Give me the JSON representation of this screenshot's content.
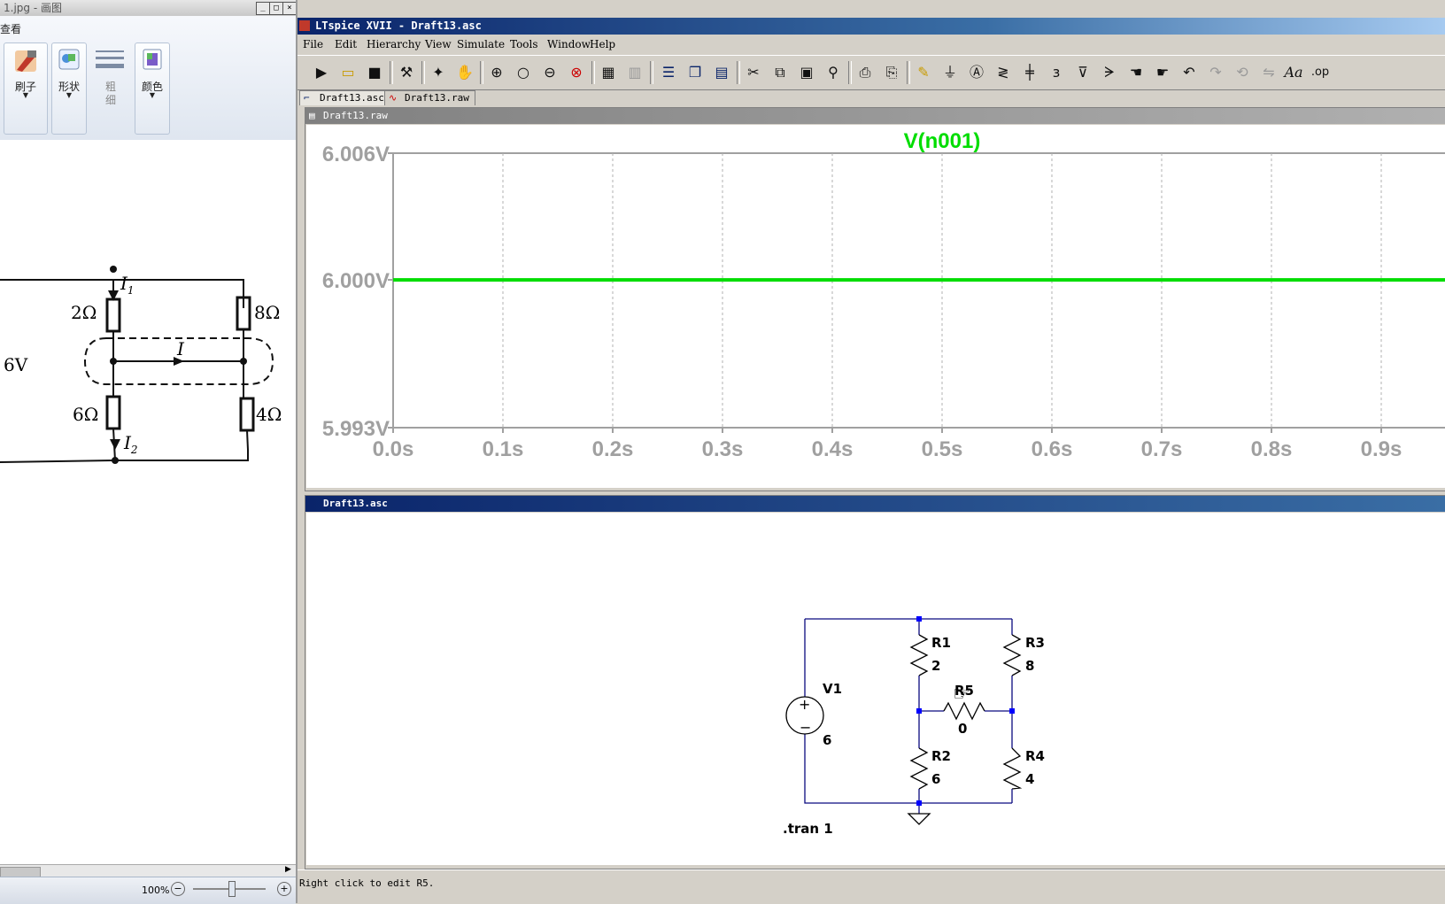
{
  "paint": {
    "title": "1.jpg - 画图",
    "tab_view": "查看",
    "ribbon": {
      "brushes": "刷子",
      "shapes": "形状",
      "size_line1": "粗",
      "size_line2": "细",
      "colors": "颜色"
    },
    "zoom": "100%",
    "figure": {
      "label_i1": "I",
      "sub_i1": "1",
      "label_i2": "I",
      "sub_i2": "2",
      "label_i": "I",
      "r_top_left": "2Ω",
      "r_top_right": "8Ω",
      "r_bot_left": "6Ω",
      "r_bot_right": "4Ω",
      "source": "6V"
    }
  },
  "ltspice": {
    "title": "LTspice XVII - Draft13.asc",
    "menu": [
      "File",
      "Edit",
      "Hierarchy",
      "View",
      "Simulate",
      "Tools",
      "Window",
      "Help"
    ],
    "tabs": [
      "Draft13.asc",
      "Draft13.raw"
    ],
    "waveform_window_title": "Draft13.raw",
    "schematic_window_title": "Draft13.asc",
    "status": "Right click to edit R5.",
    "toolbar_icons": [
      "run-icon",
      "open-icon",
      "save-icon",
      "control-panel-icon",
      "run-sim-icon",
      "pan-icon",
      "zoom-in-icon",
      "zoom-area-icon",
      "zoom-out-icon",
      "zoom-cancel-icon",
      "plot-icon",
      "plot-settings-icon",
      "tile-h-icon",
      "cascade-icon",
      "tile-v-icon",
      "cut-icon",
      "copy-icon",
      "paste-icon",
      "find-icon",
      "print-icon",
      "print-setup-icon",
      "wire-icon",
      "ground-icon",
      "label-icon",
      "resistor-icon",
      "capacitor-icon",
      "inductor-icon",
      "diode-icon",
      "component-icon",
      "move-icon",
      "drag-icon",
      "undo-icon",
      "redo-icon",
      "rotate-icon",
      "mirror-icon",
      "text-icon",
      "spice-directive-icon"
    ],
    "toolbar_glyph_text": "Aa",
    "toolbar_glyph_op": ".op",
    "schematic": {
      "v1_name": "V1",
      "v1_value": "6",
      "r1_name": "R1",
      "r1_value": "2",
      "r2_name": "R2",
      "r2_value": "6",
      "r3_name": "R3",
      "r3_value": "8",
      "r4_name": "R4",
      "r4_value": "4",
      "r5_name": "R5",
      "r5_value": "0",
      "directive": ".tran 1"
    }
  },
  "chart_data": {
    "type": "line",
    "title": "V(n001)",
    "xlabel": "",
    "ylabel": "",
    "xlim": [
      0.0,
      0.9
    ],
    "ylim": [
      5.993,
      6.006
    ],
    "x_ticks": [
      "0.0s",
      "0.1s",
      "0.2s",
      "0.3s",
      "0.4s",
      "0.5s",
      "0.6s",
      "0.7s",
      "0.8s",
      "0.9s"
    ],
    "y_ticks": [
      "6.006V",
      "6.000V",
      "5.993V"
    ],
    "series": [
      {
        "name": "V(n001)",
        "color": "#00dd00",
        "x": [
          0.0,
          0.9
        ],
        "y": [
          6.0,
          6.0
        ]
      }
    ],
    "grid": true
  }
}
